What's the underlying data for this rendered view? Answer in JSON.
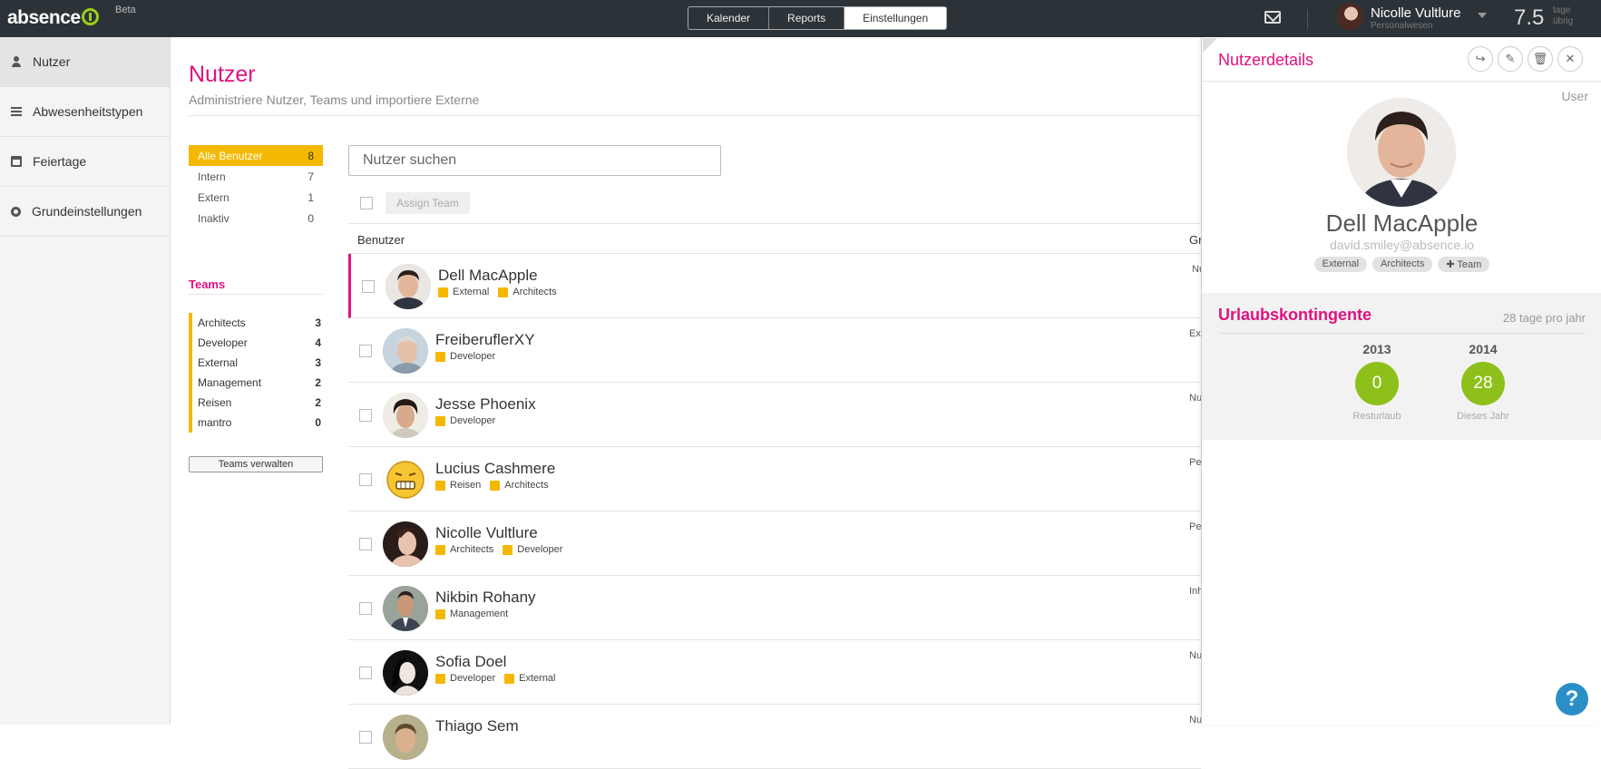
{
  "app": {
    "logo": "absence",
    "beta": "Beta"
  },
  "nav": {
    "tabs": [
      "Kalender",
      "Reports",
      "Einstellungen"
    ],
    "active": 2
  },
  "user": {
    "name": "Nicolle Vultlure",
    "role": "Personalwesen",
    "days_value": "7.5",
    "days_label_1": "tage",
    "days_label_2": "übrig"
  },
  "sidebar": {
    "items": [
      {
        "label": "Nutzer",
        "icon": "user-icon"
      },
      {
        "label": "Abwesenheitstypen",
        "icon": "list-icon"
      },
      {
        "label": "Feiertage",
        "icon": "calendar-icon"
      },
      {
        "label": "Grundeinstellungen",
        "icon": "gear-icon"
      }
    ]
  },
  "page": {
    "title": "Nutzer",
    "subtitle": "Administriere Nutzer, Teams und importiere Externe"
  },
  "filters": [
    {
      "label": "Alle Benutzer",
      "count": "8"
    },
    {
      "label": "Intern",
      "count": "7"
    },
    {
      "label": "Extern",
      "count": "1"
    },
    {
      "label": "Inaktiv",
      "count": "0"
    }
  ],
  "teams": {
    "title": "Teams",
    "items": [
      {
        "label": "Architects",
        "count": "3"
      },
      {
        "label": "Developer",
        "count": "4"
      },
      {
        "label": "External",
        "count": "3"
      },
      {
        "label": "Management",
        "count": "2"
      },
      {
        "label": "Reisen",
        "count": "2"
      },
      {
        "label": "mantro",
        "count": "0"
      }
    ],
    "manage_label": "Teams verwalten"
  },
  "search": {
    "placeholder": "Nutzer suchen"
  },
  "toolbar": {
    "assign_label": "Assign Team"
  },
  "table": {
    "header_user": "Benutzer",
    "header_gr": "Gr",
    "rows": [
      {
        "name": "Dell MacApple",
        "tags": [
          "External",
          "Architects"
        ],
        "gr": "Nu"
      },
      {
        "name": "FreiberuflerXY",
        "tags": [
          "Developer"
        ],
        "gr": "Ext"
      },
      {
        "name": "Jesse Phoenix",
        "tags": [
          "Developer"
        ],
        "gr": "Nu"
      },
      {
        "name": "Lucius Cashmere",
        "tags": [
          "Reisen",
          "Architects"
        ],
        "gr": "Pe"
      },
      {
        "name": "Nicolle Vultlure",
        "tags": [
          "Architects",
          "Developer"
        ],
        "gr": "Pe"
      },
      {
        "name": "Nikbin Rohany",
        "tags": [
          "Management"
        ],
        "gr": "Inh"
      },
      {
        "name": "Sofia Doel",
        "tags": [
          "Developer",
          "External"
        ],
        "gr": "Nu"
      },
      {
        "name": "Thiago Sem",
        "tags": [],
        "gr": "Nu"
      }
    ]
  },
  "panel": {
    "title": "Nutzerdetails",
    "role": "User",
    "name": "Dell MacApple",
    "email": "david.smiley@absence.io",
    "tags": [
      "External",
      "Architects",
      "✚ Team"
    ],
    "vacation": {
      "title": "Urlaubskontingente",
      "per_year": "28 tage pro jahr",
      "years": [
        {
          "year": "2013",
          "value": "0",
          "label": "Resturlaub"
        },
        {
          "year": "2014",
          "value": "28",
          "label": "Dieses Jahr"
        }
      ]
    }
  },
  "help": {
    "label": "?"
  },
  "colors": {
    "brand": "#e0117f",
    "team": "#f5b800",
    "vacation": "#8dc01a",
    "topbar": "#2c3338"
  }
}
